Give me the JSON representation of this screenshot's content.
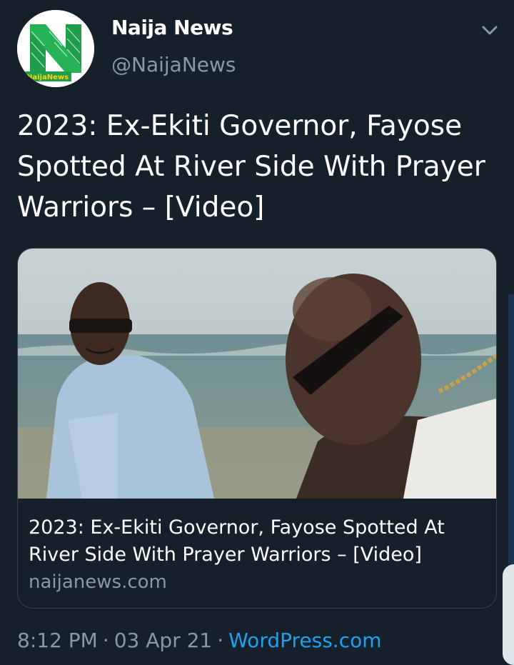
{
  "author": {
    "name": "Naija News",
    "handle": "@NaijaNews",
    "avatar_text": "NaijaNews"
  },
  "tweet": {
    "text": "2023: Ex-Ekiti Governor, Fayose Spotted At River Side With Prayer Warriors – [Video]"
  },
  "card": {
    "title": "2023: Ex-Ekiti Governor, Fayose Spotted At River Side With Prayer Warriors – [Video]",
    "domain": "naijanews.com"
  },
  "meta": {
    "time": "8:12 PM",
    "date": "03 Apr 21",
    "separator": "·",
    "source": "WordPress.com"
  },
  "colors": {
    "background": "#15202b",
    "secondary_text": "#8899a6",
    "link": "#1da1f2",
    "border": "#38444d",
    "brand_green": "#1e9e4a"
  },
  "icons": {
    "more": "chevron-down-icon"
  }
}
